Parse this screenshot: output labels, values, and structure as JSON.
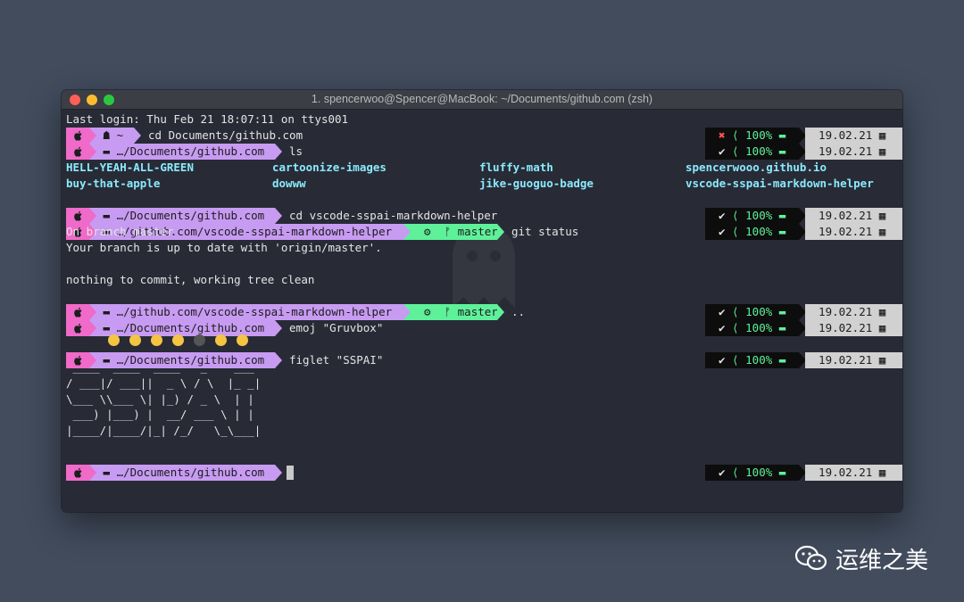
{
  "window": {
    "title": "1. spencerwoo@Spencer@MacBook: ~/Documents/github.com (zsh)"
  },
  "watermark": {
    "text": "运维之美"
  },
  "last_login": "Last login: Thu Feb 21 18:07:11 on ttys001",
  "prompts": [
    {
      "path": "~",
      "command": "cd Documents/github.com",
      "status": "✖",
      "battery": "100%",
      "date": "19.02.21"
    },
    {
      "path": "…/Documents/github.com",
      "command": "ls",
      "status": "✔",
      "battery": "100%",
      "date": "19.02.21"
    },
    {
      "path": "…/Documents/github.com",
      "command": "cd vscode-sspai-markdown-helper",
      "status": "✔",
      "battery": "100%",
      "date": "19.02.21"
    },
    {
      "path": "…/github.com/vscode-sspai-markdown-helper",
      "git": "master",
      "command": "git status",
      "status": "✔",
      "battery": "100%",
      "date": "19.02.21"
    },
    {
      "path": "…/github.com/vscode-sspai-markdown-helper",
      "git": "master",
      "command": "..",
      "status": "✔",
      "battery": "100%",
      "date": "19.02.21"
    },
    {
      "path": "…/Documents/github.com",
      "command": "emoj \"Gruvbox\"",
      "status": "✔",
      "battery": "100%",
      "date": "19.02.21"
    },
    {
      "path": "…/Documents/github.com",
      "command": "figlet \"SSPAI\"",
      "status": "✔",
      "battery": "100%",
      "date": "19.02.21"
    },
    {
      "path": "…/Documents/github.com",
      "command": "",
      "status": "✔",
      "battery": "100%",
      "date": "19.02.21"
    }
  ],
  "ls_output": [
    [
      "HELL-YEAH-ALL-GREEN",
      "cartoonize-images",
      "fluffy-math",
      "spencerwooo.github.io"
    ],
    [
      "buy-that-apple",
      "dowww",
      "jike-guoguo-badge",
      "vscode-sspai-markdown-helper"
    ]
  ],
  "git_status": [
    "On branch master",
    "Your branch is up to date with 'origin/master'.",
    "",
    "nothing to commit, working tree clean"
  ],
  "figlet": " ____  ____  ____   _    ___\n/ ___|/ ___||  _ \\ / \\  |_ _|\n\\___ \\\\___ \\| |_) / _ \\  | |\n ___) |___) |  __/ ___ \\ | |\n|____/|____/|_| /_/   \\_\\___|",
  "colors": {
    "pink": "#f06ac9",
    "lavender": "#c79bf2",
    "git_green": "#5ef19a",
    "background": "#282b36"
  },
  "icons": {
    "os": "apple-icon",
    "home": "home-icon",
    "folder": "folder-icon",
    "git": "git-branch-icon",
    "calendar": "calendar-icon",
    "battery": "battery-icon"
  }
}
